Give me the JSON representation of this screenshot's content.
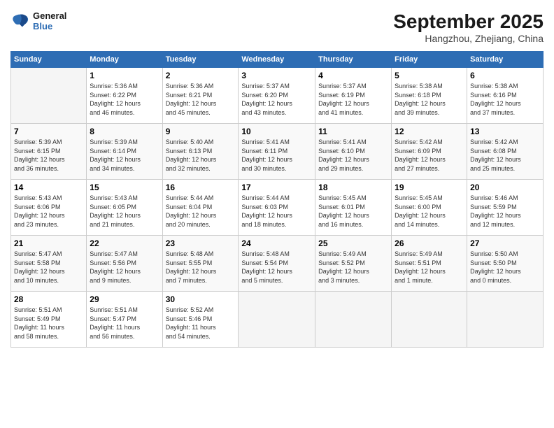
{
  "logo": {
    "line1": "General",
    "line2": "Blue"
  },
  "title": "September 2025",
  "location": "Hangzhou, Zhejiang, China",
  "days_of_week": [
    "Sunday",
    "Monday",
    "Tuesday",
    "Wednesday",
    "Thursday",
    "Friday",
    "Saturday"
  ],
  "weeks": [
    [
      {
        "day": "",
        "info": ""
      },
      {
        "day": "1",
        "info": "Sunrise: 5:36 AM\nSunset: 6:22 PM\nDaylight: 12 hours\nand 46 minutes."
      },
      {
        "day": "2",
        "info": "Sunrise: 5:36 AM\nSunset: 6:21 PM\nDaylight: 12 hours\nand 45 minutes."
      },
      {
        "day": "3",
        "info": "Sunrise: 5:37 AM\nSunset: 6:20 PM\nDaylight: 12 hours\nand 43 minutes."
      },
      {
        "day": "4",
        "info": "Sunrise: 5:37 AM\nSunset: 6:19 PM\nDaylight: 12 hours\nand 41 minutes."
      },
      {
        "day": "5",
        "info": "Sunrise: 5:38 AM\nSunset: 6:18 PM\nDaylight: 12 hours\nand 39 minutes."
      },
      {
        "day": "6",
        "info": "Sunrise: 5:38 AM\nSunset: 6:16 PM\nDaylight: 12 hours\nand 37 minutes."
      }
    ],
    [
      {
        "day": "7",
        "info": "Sunrise: 5:39 AM\nSunset: 6:15 PM\nDaylight: 12 hours\nand 36 minutes."
      },
      {
        "day": "8",
        "info": "Sunrise: 5:39 AM\nSunset: 6:14 PM\nDaylight: 12 hours\nand 34 minutes."
      },
      {
        "day": "9",
        "info": "Sunrise: 5:40 AM\nSunset: 6:13 PM\nDaylight: 12 hours\nand 32 minutes."
      },
      {
        "day": "10",
        "info": "Sunrise: 5:41 AM\nSunset: 6:11 PM\nDaylight: 12 hours\nand 30 minutes."
      },
      {
        "day": "11",
        "info": "Sunrise: 5:41 AM\nSunset: 6:10 PM\nDaylight: 12 hours\nand 29 minutes."
      },
      {
        "day": "12",
        "info": "Sunrise: 5:42 AM\nSunset: 6:09 PM\nDaylight: 12 hours\nand 27 minutes."
      },
      {
        "day": "13",
        "info": "Sunrise: 5:42 AM\nSunset: 6:08 PM\nDaylight: 12 hours\nand 25 minutes."
      }
    ],
    [
      {
        "day": "14",
        "info": "Sunrise: 5:43 AM\nSunset: 6:06 PM\nDaylight: 12 hours\nand 23 minutes."
      },
      {
        "day": "15",
        "info": "Sunrise: 5:43 AM\nSunset: 6:05 PM\nDaylight: 12 hours\nand 21 minutes."
      },
      {
        "day": "16",
        "info": "Sunrise: 5:44 AM\nSunset: 6:04 PM\nDaylight: 12 hours\nand 20 minutes."
      },
      {
        "day": "17",
        "info": "Sunrise: 5:44 AM\nSunset: 6:03 PM\nDaylight: 12 hours\nand 18 minutes."
      },
      {
        "day": "18",
        "info": "Sunrise: 5:45 AM\nSunset: 6:01 PM\nDaylight: 12 hours\nand 16 minutes."
      },
      {
        "day": "19",
        "info": "Sunrise: 5:45 AM\nSunset: 6:00 PM\nDaylight: 12 hours\nand 14 minutes."
      },
      {
        "day": "20",
        "info": "Sunrise: 5:46 AM\nSunset: 5:59 PM\nDaylight: 12 hours\nand 12 minutes."
      }
    ],
    [
      {
        "day": "21",
        "info": "Sunrise: 5:47 AM\nSunset: 5:58 PM\nDaylight: 12 hours\nand 10 minutes."
      },
      {
        "day": "22",
        "info": "Sunrise: 5:47 AM\nSunset: 5:56 PM\nDaylight: 12 hours\nand 9 minutes."
      },
      {
        "day": "23",
        "info": "Sunrise: 5:48 AM\nSunset: 5:55 PM\nDaylight: 12 hours\nand 7 minutes."
      },
      {
        "day": "24",
        "info": "Sunrise: 5:48 AM\nSunset: 5:54 PM\nDaylight: 12 hours\nand 5 minutes."
      },
      {
        "day": "25",
        "info": "Sunrise: 5:49 AM\nSunset: 5:52 PM\nDaylight: 12 hours\nand 3 minutes."
      },
      {
        "day": "26",
        "info": "Sunrise: 5:49 AM\nSunset: 5:51 PM\nDaylight: 12 hours\nand 1 minute."
      },
      {
        "day": "27",
        "info": "Sunrise: 5:50 AM\nSunset: 5:50 PM\nDaylight: 12 hours\nand 0 minutes."
      }
    ],
    [
      {
        "day": "28",
        "info": "Sunrise: 5:51 AM\nSunset: 5:49 PM\nDaylight: 11 hours\nand 58 minutes."
      },
      {
        "day": "29",
        "info": "Sunrise: 5:51 AM\nSunset: 5:47 PM\nDaylight: 11 hours\nand 56 minutes."
      },
      {
        "day": "30",
        "info": "Sunrise: 5:52 AM\nSunset: 5:46 PM\nDaylight: 11 hours\nand 54 minutes."
      },
      {
        "day": "",
        "info": ""
      },
      {
        "day": "",
        "info": ""
      },
      {
        "day": "",
        "info": ""
      },
      {
        "day": "",
        "info": ""
      }
    ]
  ]
}
